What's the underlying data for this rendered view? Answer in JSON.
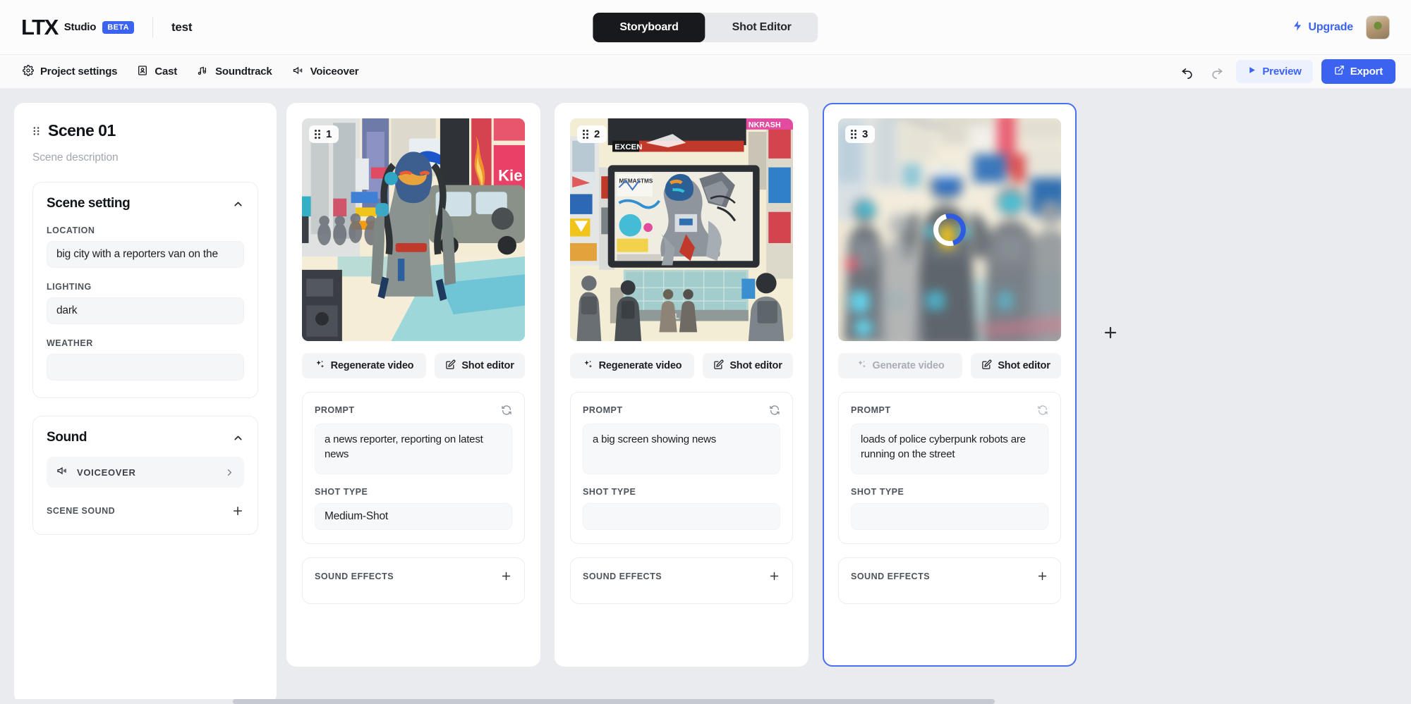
{
  "brand": {
    "logo_text": "LTX",
    "studio_text": "Studio",
    "beta_badge": "BETA"
  },
  "header": {
    "project_title": "test",
    "mode_tabs": [
      {
        "label": "Storyboard",
        "active": true
      },
      {
        "label": "Shot Editor",
        "active": false
      }
    ],
    "upgrade_label": "Upgrade",
    "upgrade_color": "#3b63f0",
    "avatar_name": "user-avatar"
  },
  "toolbar": {
    "items": [
      {
        "label": "Project settings",
        "icon": "gear-icon"
      },
      {
        "label": "Cast",
        "icon": "person-card-icon"
      },
      {
        "label": "Soundtrack",
        "icon": "music-note-icon"
      },
      {
        "label": "Voiceover",
        "icon": "megaphone-icon"
      }
    ],
    "undo_icon": "undo-arrow-icon",
    "redo_icon": "redo-arrow-icon",
    "preview_label": "Preview",
    "export_label": "Export",
    "export_color": "#3b63f0"
  },
  "scene": {
    "title": "Scene 01",
    "description_placeholder": "Scene description",
    "setting_section": {
      "title": "Scene setting",
      "collapsed": false,
      "fields": [
        {
          "label": "LOCATION",
          "value": "big city with a reporters van on the"
        },
        {
          "label": "LIGHTING",
          "value": "dark"
        },
        {
          "label": "WEATHER",
          "value": ""
        }
      ]
    },
    "sound_section": {
      "title": "Sound",
      "collapsed": false,
      "voiceover_label": "VOICEOVER",
      "scene_sound_label": "SCENE SOUND",
      "add_icon": "plus-icon"
    }
  },
  "shots": [
    {
      "number": "1",
      "selected": false,
      "loading": false,
      "generate_label": "Regenerate video",
      "shot_editor_label": "Shot editor",
      "generate_disabled": false,
      "prompt_label": "PROMPT",
      "prompt_value": "a news reporter, reporting on latest news",
      "shot_type_label": "SHOT TYPE",
      "shot_type_value": "Medium-Shot",
      "sound_effects_label": "SOUND EFFECTS",
      "thumb_alt": "cyberpunk news reporter woman on a busy city street with a van and fire"
    },
    {
      "number": "2",
      "selected": false,
      "loading": false,
      "generate_label": "Regenerate video",
      "shot_editor_label": "Shot editor",
      "generate_disabled": false,
      "prompt_label": "PROMPT",
      "prompt_value": "a big screen showing news",
      "shot_type_label": "SHOT TYPE",
      "shot_type_value": "",
      "sound_effects_label": "SOUND EFFECTS",
      "thumb_alt": "giant billboard screen showing a mech robot with people watching"
    },
    {
      "number": "3",
      "selected": true,
      "loading": true,
      "generate_label": "Generate video",
      "shot_editor_label": "Shot editor",
      "generate_disabled": true,
      "prompt_label": "PROMPT",
      "prompt_value": "loads of police cyberpunk robots are running on the street",
      "shot_type_label": "SHOT TYPE",
      "shot_type_value": "",
      "sound_effects_label": "SOUND EFFECTS",
      "thumb_alt": "blurred squad of cyberpunk police robots marching on a street"
    }
  ],
  "add_shot": {
    "icon": "plus-icon"
  }
}
